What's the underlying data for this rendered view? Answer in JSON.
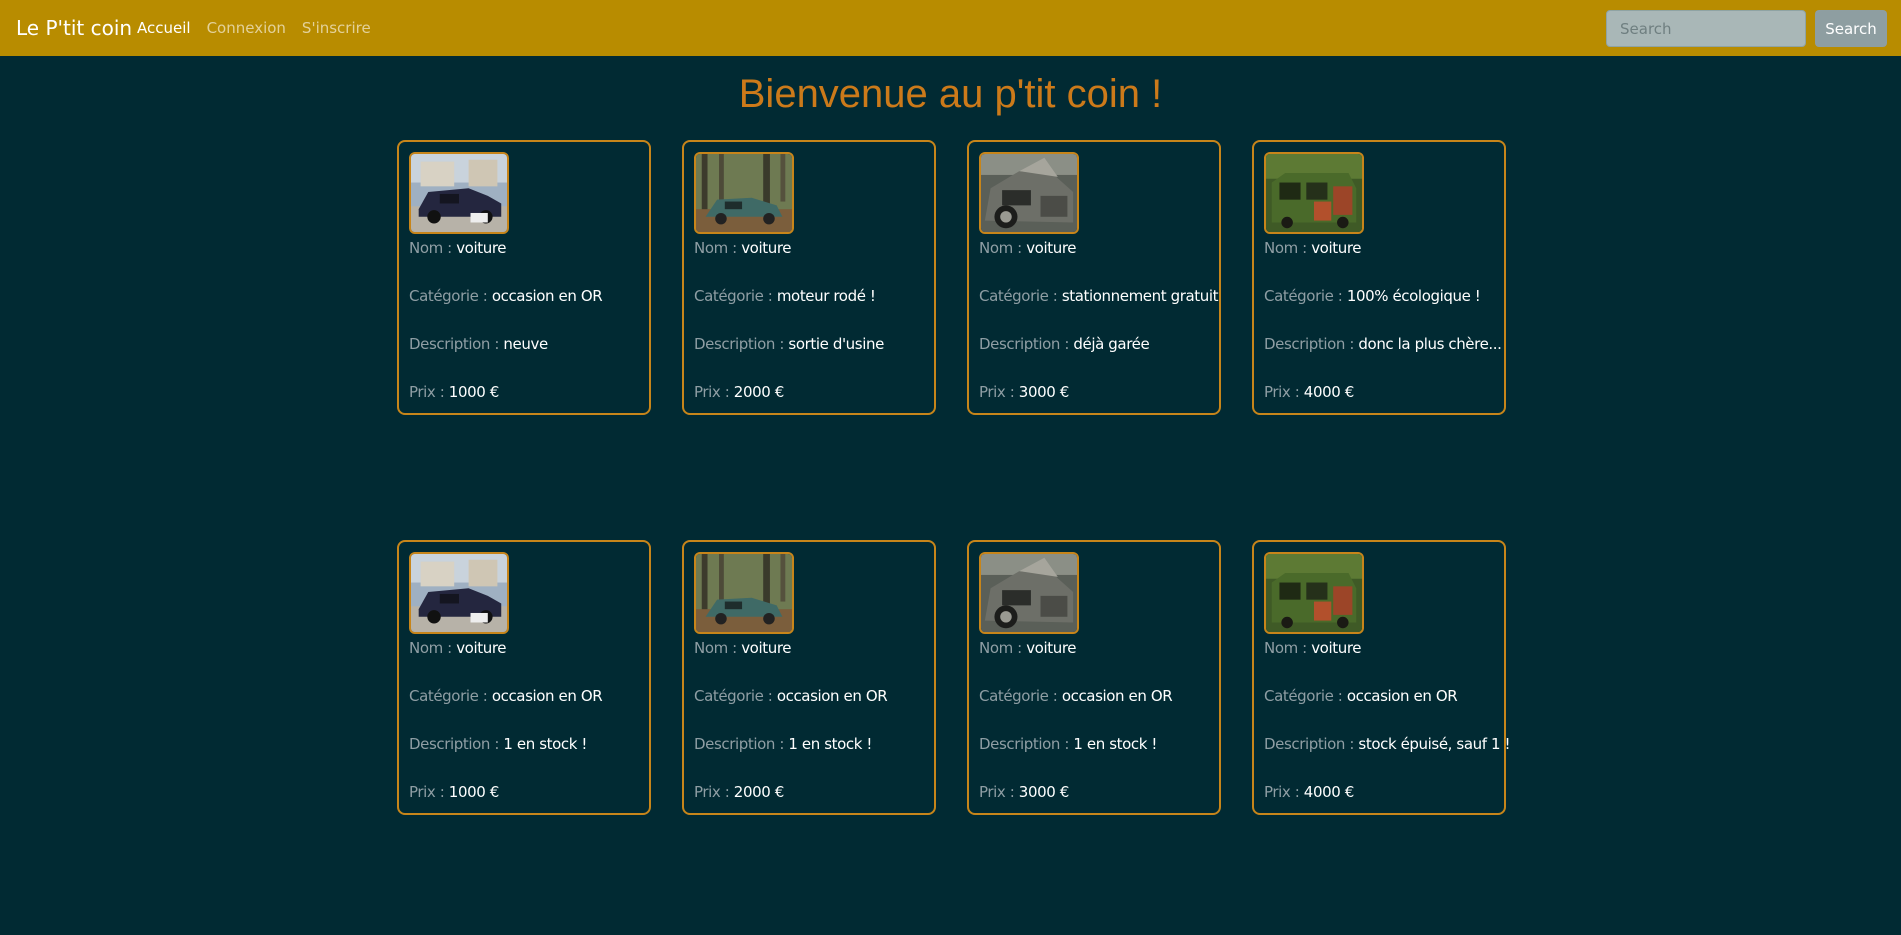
{
  "navbar": {
    "brand": "Le P'tit coin",
    "links": [
      "Accueil",
      "Connexion",
      "S'inscrire"
    ],
    "search_placeholder": "Search",
    "search_button": "Search"
  },
  "page_title": "Bienvenue au p'tit coin !",
  "labels": {
    "nom": "Nom : ",
    "categorie": "Catégorie : ",
    "description": "Description : ",
    "prix": "Prix : "
  },
  "cards": [
    {
      "image": "car-photo-1",
      "nom": "voiture",
      "categorie": "occasion en OR",
      "description": "neuve",
      "prix": "1000 €"
    },
    {
      "image": "car-photo-2",
      "nom": "voiture",
      "categorie": "moteur rodé !",
      "description": "sortie d'usine",
      "prix": "2000 €"
    },
    {
      "image": "car-photo-3",
      "nom": "voiture",
      "categorie": "stationnement gratuit",
      "description": "déjà garée",
      "prix": "3000 €"
    },
    {
      "image": "car-photo-4",
      "nom": "voiture",
      "categorie": "100% écologique !",
      "description": "donc la plus chère...",
      "prix": "4000 €"
    },
    {
      "image": "car-photo-1",
      "nom": "voiture",
      "categorie": "occasion en OR",
      "description": "1 en stock !",
      "prix": "1000 €"
    },
    {
      "image": "car-photo-2",
      "nom": "voiture",
      "categorie": "occasion en OR",
      "description": "1 en stock !",
      "prix": "2000 €"
    },
    {
      "image": "car-photo-3",
      "nom": "voiture",
      "categorie": "occasion en OR",
      "description": "1 en stock !",
      "prix": "3000 €"
    },
    {
      "image": "car-photo-4",
      "nom": "voiture",
      "categorie": "occasion en OR",
      "description": "stock épuisé, sauf 1 !",
      "prix": "4000 €"
    }
  ]
}
